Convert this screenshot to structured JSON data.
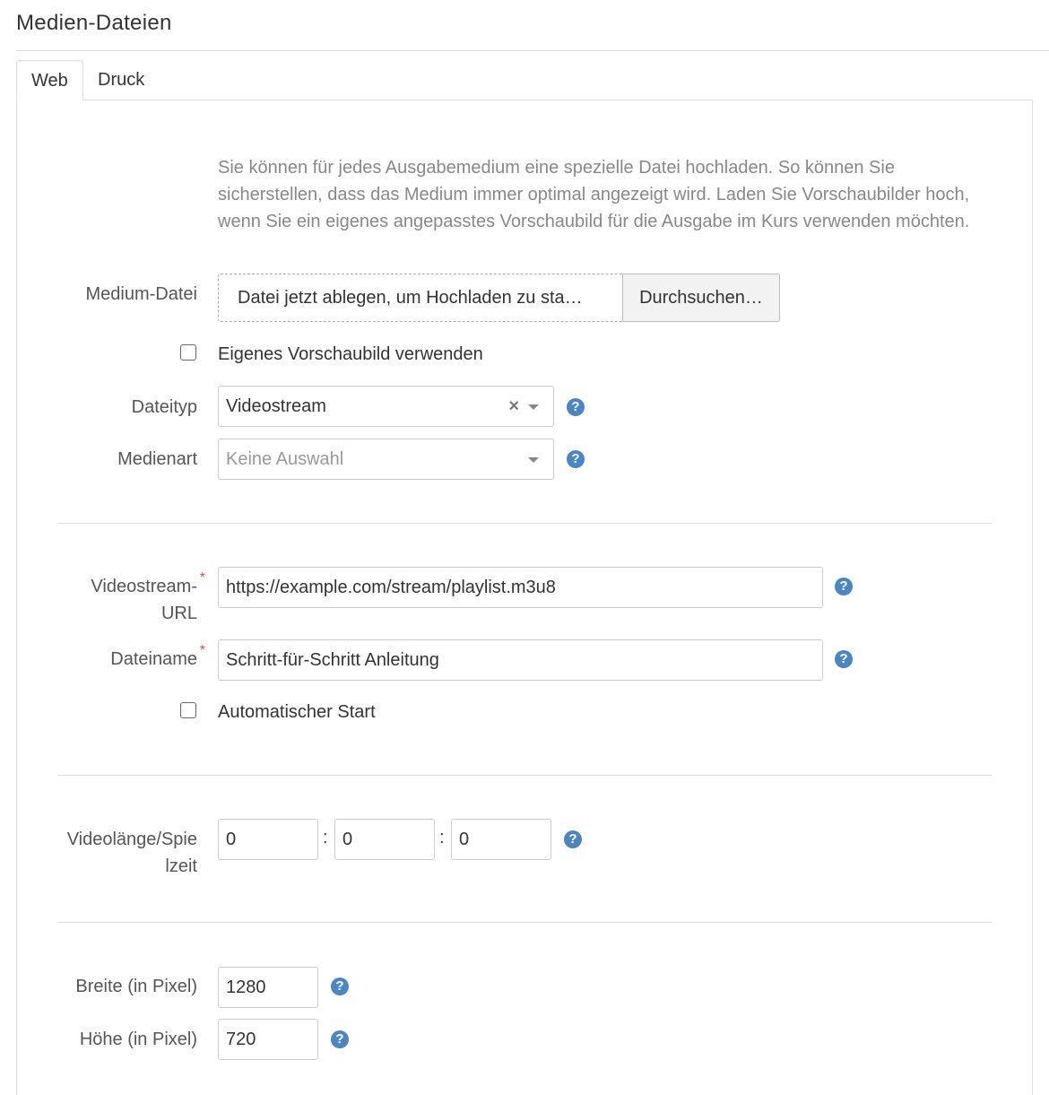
{
  "page": {
    "title": "Medien-Dateien"
  },
  "tabs": [
    {
      "label": "Web",
      "active": true
    },
    {
      "label": "Druck",
      "active": false
    }
  ],
  "intro_text": "Sie können für jedes Ausgabemedium eine spezielle Datei hochladen. So können Sie sicherstellen, dass das Medium immer optimal angezeigt wird. Laden Sie Vorschaubilder hoch, wenn Sie ein eigenes angepasstes Vorschaubild für die Ausgabe im Kurs verwenden möchten.",
  "medium_file": {
    "label": "Medium-Datei",
    "dropzone_text": "Datei jetzt ablegen, um Hochladen zu sta…",
    "browse_label": "Durchsuchen…"
  },
  "custom_thumbnail": {
    "label": "Eigenes Vorschaubild verwenden",
    "checked": false
  },
  "file_type": {
    "label": "Dateityp",
    "value": "Videostream",
    "clear": "×"
  },
  "media_type": {
    "label": "Medienart",
    "placeholder": "Keine Auswahl"
  },
  "stream_url": {
    "label_line1": "Videostream-",
    "label_line2": "URL",
    "required": "*",
    "value": "https://example.com/stream/playlist.m3u8"
  },
  "file_name": {
    "label": "Dateiname",
    "required": "*",
    "value": "Schritt-für-Schritt Anleitung"
  },
  "autostart": {
    "label": "Automatischer Start",
    "checked": false
  },
  "duration": {
    "label_line1": "Videolänge/Spie",
    "label_line2": "lzeit",
    "hours": "0",
    "minutes": "0",
    "seconds": "0",
    "separator": ":"
  },
  "width": {
    "label": "Breite (in Pixel)",
    "value": "1280"
  },
  "height": {
    "label": "Höhe (in Pixel)",
    "value": "720"
  },
  "help_glyph": "?",
  "colors": {
    "help_icon": "#4a86c5",
    "required": "#d9534f",
    "muted_text": "#888888"
  }
}
